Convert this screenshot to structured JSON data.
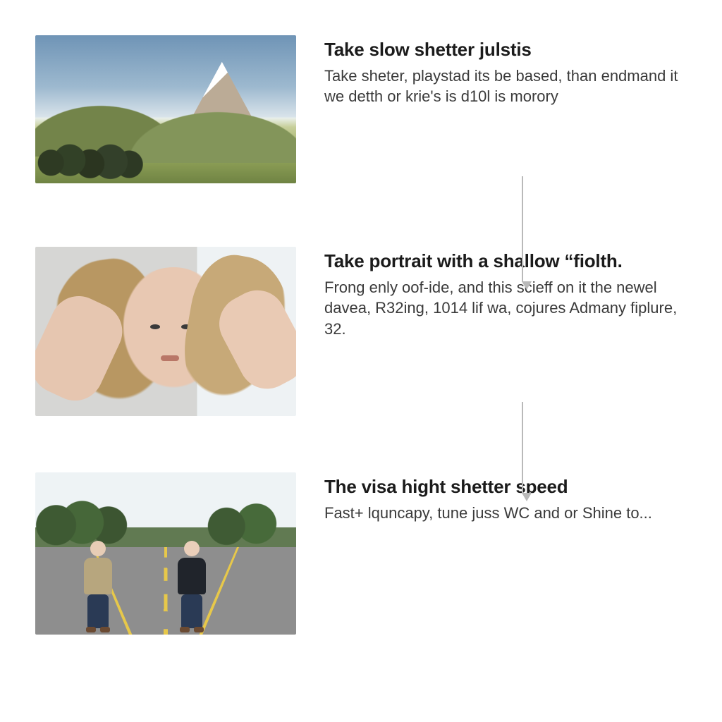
{
  "steps": [
    {
      "title": "Take slow shetter julstis",
      "body": "Take sheter, playstad its be based, than endmand it we detth or krie's is d10l is morory"
    },
    {
      "title": "Take portrait with a shallow “fiolth.",
      "body": "Frong enly oof-ide, and this scieff on it the newel davea, R32ing, 1014 lif wa, cojures Admany fiplure, 32."
    },
    {
      "title": "The visa hight shetter speed",
      "body": "Fast+ lquncapy, tune juss WC and or Shine to..."
    }
  ]
}
